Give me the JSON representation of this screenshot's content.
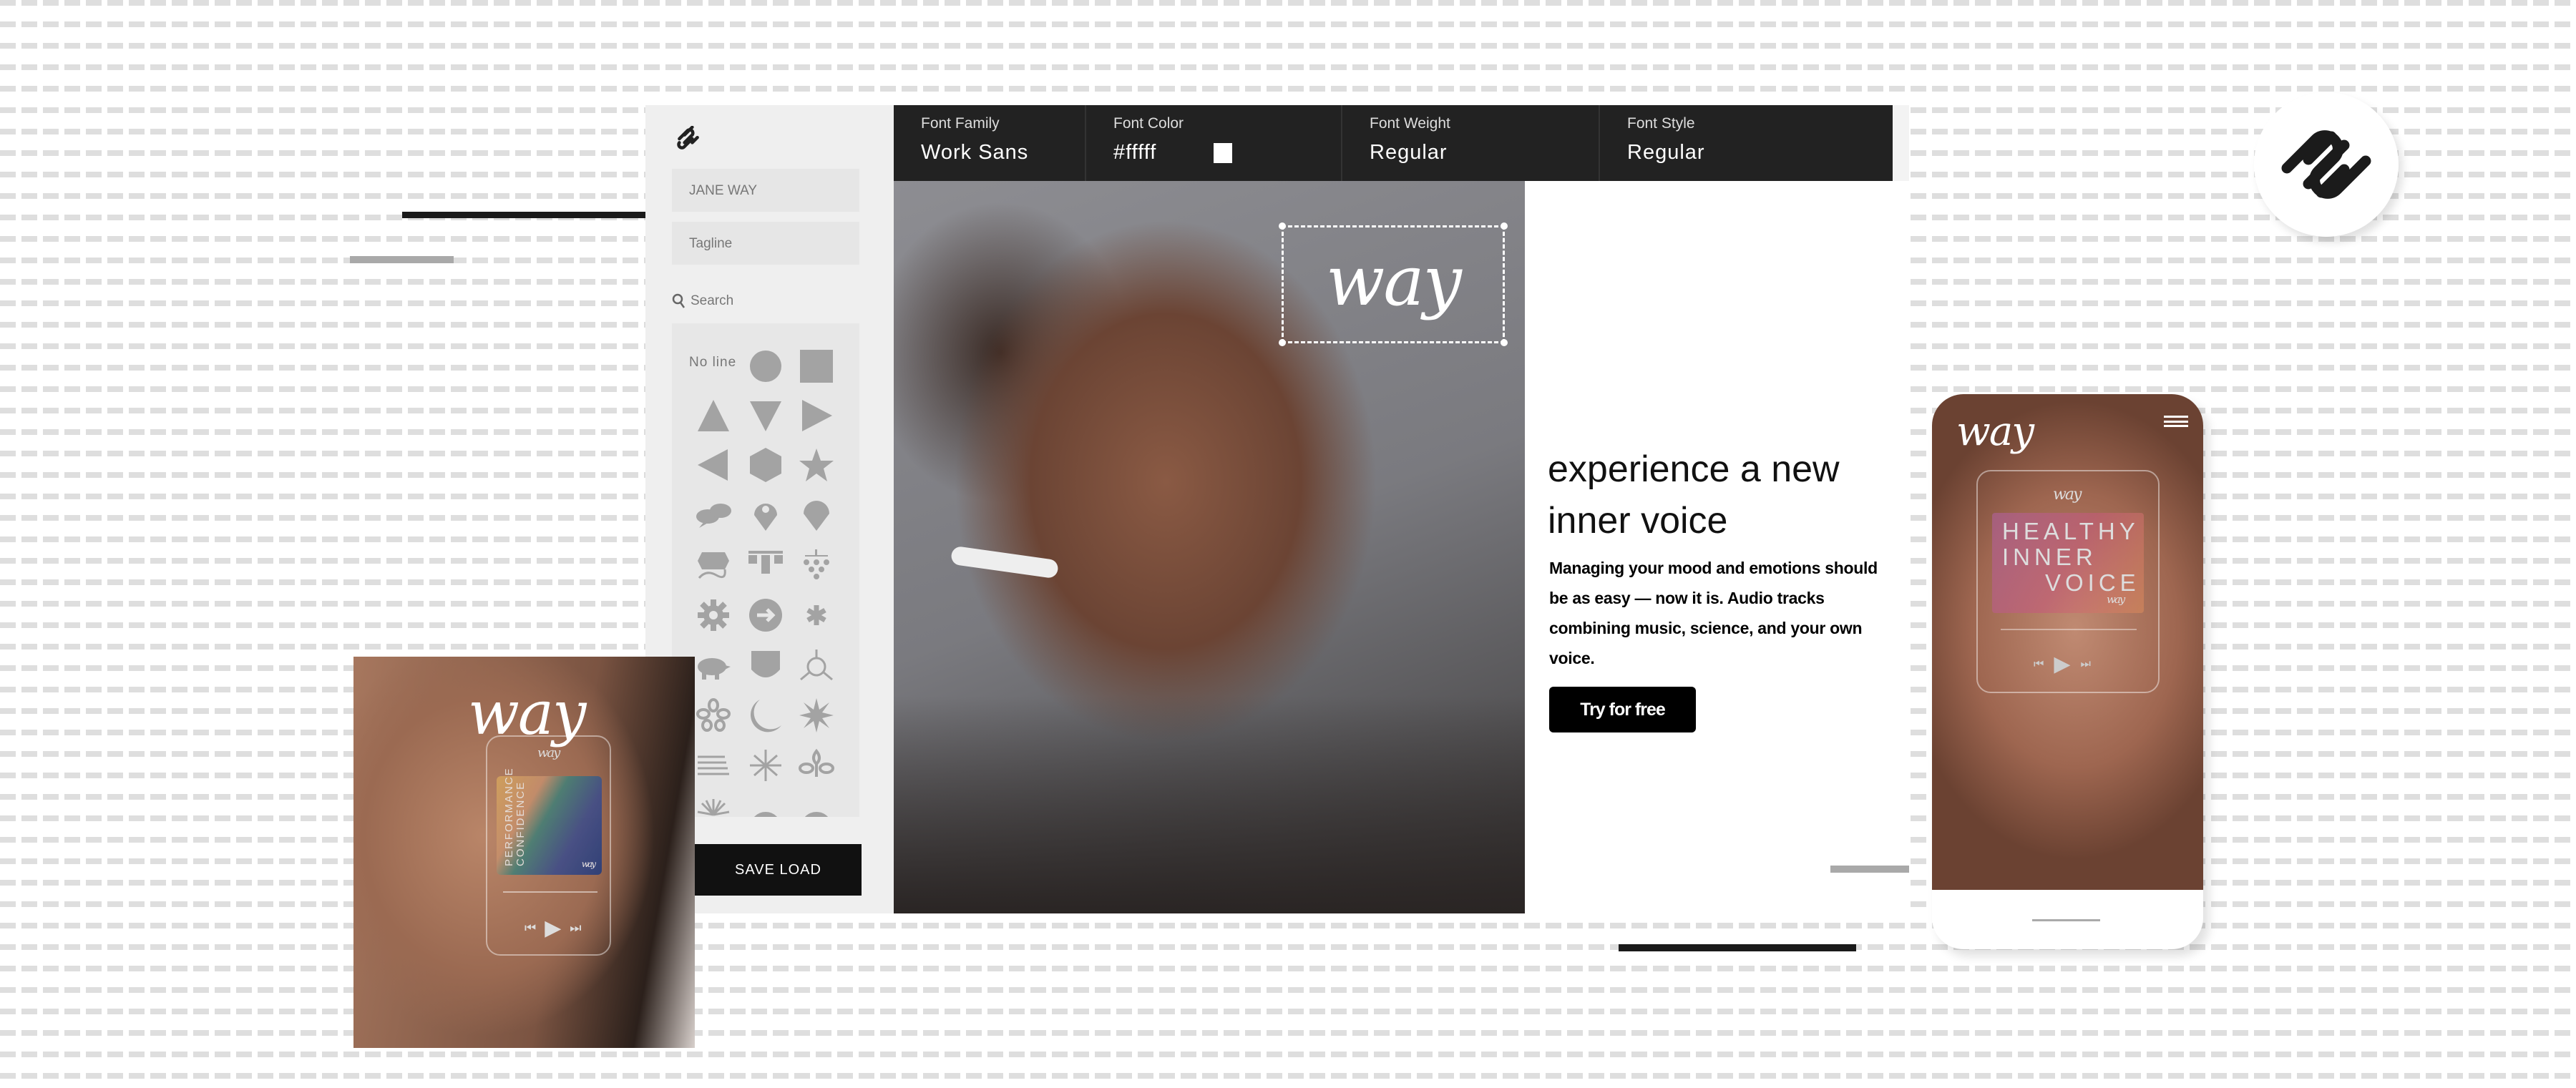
{
  "colors": {
    "toolbar_bg": "#222222",
    "accent": "#000000",
    "shape_gray": "#a3a3a3",
    "sidebar_bg": "#efefef"
  },
  "brand": {
    "wordmark": "way",
    "platform_logo": "squarespace-logo"
  },
  "sidebar": {
    "logo_icon": "squarespace-logo-icon",
    "site_title_value": "JANE WAY",
    "tagline_placeholder": "Tagline",
    "search_label": "Search",
    "search_icon": "search-icon",
    "shapes_no_line": "No line",
    "shapes": [
      "circle",
      "square",
      "triangle-up",
      "triangle-down",
      "triangle-right",
      "triangle-left",
      "hexagon",
      "star",
      "speech-bubbles",
      "map-pin",
      "drop-pin",
      "hex-bubble",
      "tee-blocks",
      "dot-cluster",
      "gear",
      "arrow-circle",
      "asterisk",
      "pig",
      "shield",
      "sun-outline",
      "flower",
      "moon",
      "starburst",
      "lines",
      "spark",
      "leaf-trio",
      "sunrise",
      "ring",
      "half-circle"
    ],
    "save_load_label": "SAVE LOAD"
  },
  "toolbar": {
    "font_family": {
      "label": "Font Family",
      "value": "Work Sans"
    },
    "font_color": {
      "label": "Font Color",
      "value": "#fffff",
      "swatch": "#ffffff"
    },
    "font_weight": {
      "label": "Font Weight",
      "value": "Regular"
    },
    "font_style": {
      "label": "Font Style",
      "value": "Regular"
    }
  },
  "hero": {
    "logo": "way",
    "headline_line1": "experience a new",
    "headline_line2": "inner voice",
    "body": "Managing your mood and emotions should be as easy — now it is. Audio tracks combining music, science, and your own voice.",
    "cta": "Try for free"
  },
  "card": {
    "logo": "way",
    "player_logo": "way",
    "album_title_line1": "PERFORMANCE",
    "album_title_line2": "CONFIDENCE",
    "album_logo": "way"
  },
  "phone": {
    "logo": "way",
    "menu_icon": "hamburger-icon",
    "player_logo": "way",
    "album_line1": "HEALTHY",
    "album_line2": "INNER",
    "album_line3": "VOICE",
    "album_logo": "way"
  }
}
